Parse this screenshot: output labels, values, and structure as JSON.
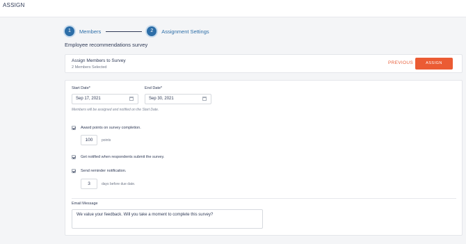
{
  "header": {
    "title": "ASSIGN"
  },
  "stepper": {
    "steps": [
      {
        "number": "1",
        "label": "Members"
      },
      {
        "number": "2",
        "label": "Assignment Settings"
      }
    ]
  },
  "survey": {
    "title": "Employee recommendations survey"
  },
  "assign_card": {
    "heading": "Assign Members to Survey",
    "subheading": "2 Members Selected",
    "previous_label": "PREVIOUS",
    "assign_label": "ASSIGN",
    "accent_color": "#eb5b33"
  },
  "form": {
    "start_date": {
      "label": "Start Date*",
      "value": "Sep 17, 2021"
    },
    "end_date": {
      "label": "End Date*",
      "value": "Sep 30, 2021"
    },
    "date_note": "Members will be assigned and notified on the Start Date.",
    "award_points": {
      "label": "Award points on survey completion.",
      "value": "100",
      "unit": "points"
    },
    "notify": {
      "label": "Get notified when respondents submit the survey."
    },
    "reminder": {
      "label": "Send reminder notification.",
      "value": "3",
      "unit": "days before due date."
    },
    "email_message": {
      "label": "Email Message",
      "value": "We value your feedback. Will you take a moment to complete this survey?"
    }
  }
}
